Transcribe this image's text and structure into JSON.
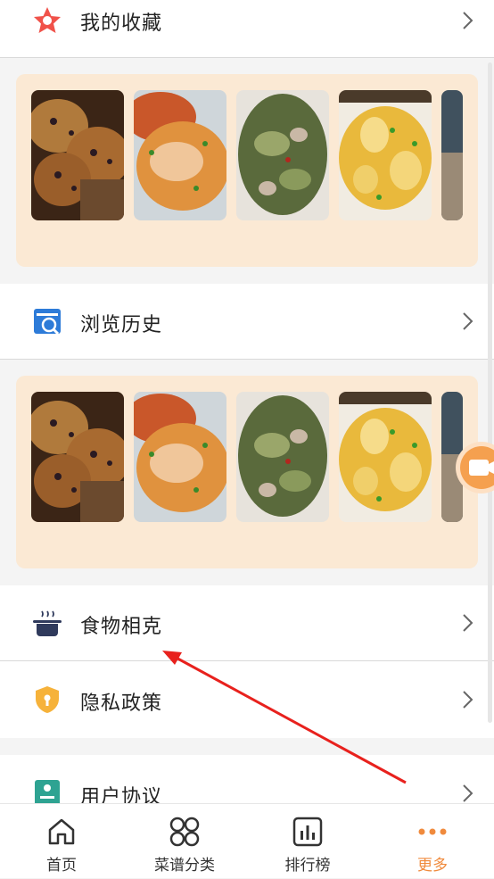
{
  "menu": {
    "favorites_label": "我的收藏",
    "history_label": "浏览历史",
    "food_conflict_label": "食物相克",
    "privacy_label": "隐私政策",
    "agreement_label": "用户协议"
  },
  "tabs": [
    {
      "label": "首页",
      "icon": "home-icon"
    },
    {
      "label": "菜谱分类",
      "icon": "grid-icon"
    },
    {
      "label": "排行榜",
      "icon": "chart-icon"
    },
    {
      "label": "更多",
      "icon": "more-icon",
      "active": true
    }
  ],
  "thumbnails": [
    "blueberry-muffins",
    "crab-fried-rice",
    "stir-fried-greens",
    "braised-winter-melon",
    "partial-dish"
  ],
  "colors": {
    "accent": "#f08a3c",
    "strip_bg": "#fbe9d4",
    "star": "#f0524a"
  }
}
